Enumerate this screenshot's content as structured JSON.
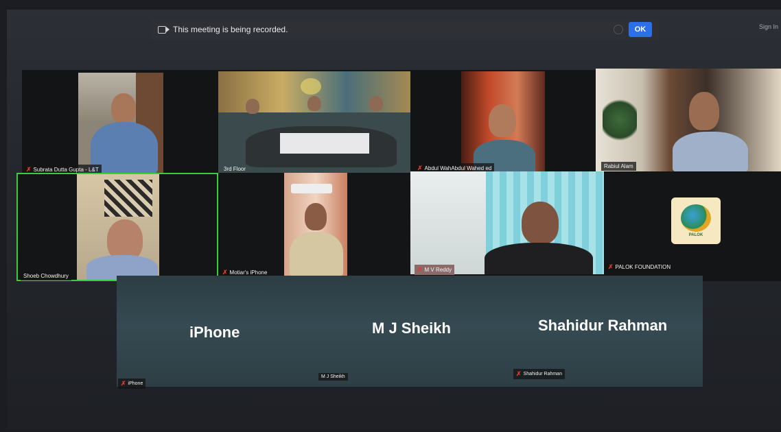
{
  "banner": {
    "message": "This meeting is being recorded.",
    "ok_label": "OK"
  },
  "top_right": {
    "signin_label": "Sign In"
  },
  "participants_row1": [
    {
      "name": "Subrata Dutta Gupta - L&T",
      "muted": true
    },
    {
      "name": "3rd Floor",
      "muted": false
    },
    {
      "name": "Abdul WahAbdul Wahed ed",
      "muted": true
    },
    {
      "name": "Rabiul Alam",
      "muted": false
    }
  ],
  "participants_row2": [
    {
      "name": "Shoeb Chowdhury",
      "muted": false,
      "active_speaker": true
    },
    {
      "name": "Motiar's iPhone",
      "muted": true
    },
    {
      "name": "M V Reddy",
      "muted": true
    },
    {
      "name": "PALOK FOUNDATION",
      "muted": true
    }
  ],
  "logo": {
    "text": "PALOK"
  },
  "audio_only": [
    {
      "display_name": "iPhone",
      "tag": "iPhone",
      "muted": true
    },
    {
      "display_name": "M J Sheikh",
      "tag": "M J Sheikh",
      "muted": false
    },
    {
      "display_name": "Shahidur Rahman",
      "tag": "Shahidur Rahman",
      "muted": true
    }
  ],
  "colors": {
    "active_speaker_border": "#35d13a",
    "ok_button": "#2d6fe6",
    "mute_icon": "#e23a2e"
  }
}
